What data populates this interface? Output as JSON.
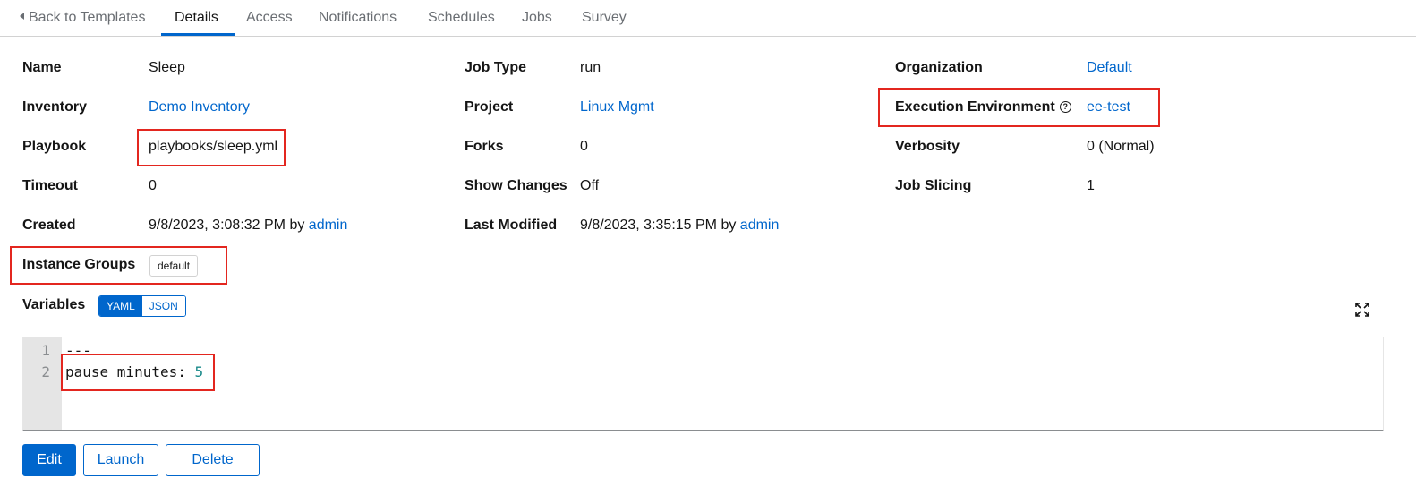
{
  "tabs": {
    "back": "Back to Templates",
    "items": [
      "Details",
      "Access",
      "Notifications",
      "Schedules",
      "Jobs",
      "Survey"
    ],
    "active": "Details"
  },
  "details": {
    "name": {
      "label": "Name",
      "value": "Sleep"
    },
    "inventory": {
      "label": "Inventory",
      "value": "Demo Inventory"
    },
    "playbook": {
      "label": "Playbook",
      "value": "playbooks/sleep.yml"
    },
    "timeout": {
      "label": "Timeout",
      "value": "0"
    },
    "created": {
      "label": "Created",
      "value": "9/8/2023, 3:08:32 PM by",
      "user": "admin"
    },
    "instance_groups": {
      "label": "Instance Groups",
      "chip": "default"
    },
    "job_type": {
      "label": "Job Type",
      "value": "run"
    },
    "project": {
      "label": "Project",
      "value": "Linux Mgmt"
    },
    "forks": {
      "label": "Forks",
      "value": "0"
    },
    "show_changes": {
      "label": "Show Changes",
      "value": "Off"
    },
    "last_modified": {
      "label": "Last Modified",
      "value": "9/8/2023, 3:35:15 PM by",
      "user": "admin"
    },
    "organization": {
      "label": "Organization",
      "value": "Default"
    },
    "execution_environment": {
      "label": "Execution Environment",
      "value": "ee-test"
    },
    "verbosity": {
      "label": "Verbosity",
      "value": "0 (Normal)"
    },
    "job_slicing": {
      "label": "Job Slicing",
      "value": "1"
    }
  },
  "variables": {
    "label": "Variables",
    "yaml_label": "YAML",
    "json_label": "JSON",
    "mode": "YAML",
    "lines": [
      {
        "number": "1",
        "key": "---",
        "value": ""
      },
      {
        "number": "2",
        "key": "pause_minutes: ",
        "value": "5"
      }
    ]
  },
  "actions": {
    "edit": "Edit",
    "launch": "Launch",
    "delete": "Delete"
  },
  "colors": {
    "accent": "#0066cc",
    "highlight_box": "#e3261f",
    "yaml_number": "#1a8a8a"
  }
}
